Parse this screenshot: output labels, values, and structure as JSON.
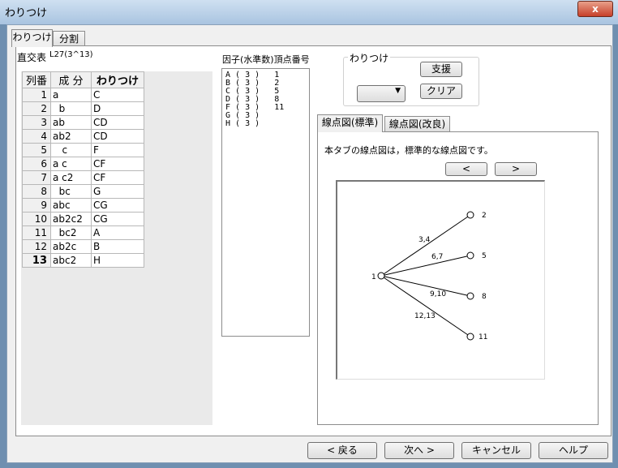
{
  "window": {
    "title": "わりつけ",
    "close_glyph": "x"
  },
  "tabs": [
    {
      "label": "わりつけ"
    },
    {
      "label": "分割"
    }
  ],
  "table_label": "直交表",
  "table_value": "L27(3^13)",
  "columns": [
    "列番",
    "成 分",
    "わりつけ"
  ],
  "rows": [
    {
      "num": "1",
      "comp": "a",
      "assign": "C"
    },
    {
      "num": "2",
      "comp": "  b",
      "assign": "D"
    },
    {
      "num": "3",
      "comp": "ab",
      "assign": "CD"
    },
    {
      "num": "4",
      "comp": "ab2",
      "assign": "CD"
    },
    {
      "num": "5",
      "comp": "   c",
      "assign": "F"
    },
    {
      "num": "6",
      "comp": "a c",
      "assign": "CF"
    },
    {
      "num": "7",
      "comp": "a c2",
      "assign": "CF"
    },
    {
      "num": "8",
      "comp": "  bc",
      "assign": "G"
    },
    {
      "num": "9",
      "comp": "abc",
      "assign": "CG"
    },
    {
      "num": "10",
      "comp": "ab2c2",
      "assign": "CG"
    },
    {
      "num": "11",
      "comp": "  bc2",
      "assign": "A"
    },
    {
      "num": "12",
      "comp": "ab2c",
      "assign": "B"
    },
    {
      "num": "13",
      "comp": "abc2",
      "assign": "H"
    }
  ],
  "factor_list": {
    "header": "因子(水準数)頂点番号",
    "lines": [
      "A ( 3 )   1",
      "B ( 3 )   2",
      "C ( 3 )   5",
      "D ( 3 )   8",
      "F ( 3 )   11",
      "G ( 3 )",
      "H ( 3 )"
    ]
  },
  "assign_group": {
    "label": "わりつけ",
    "support": "支援",
    "clear": "クリア",
    "combo_value": ""
  },
  "subtabs": [
    {
      "label": "線点図(標準)"
    },
    {
      "label": "線点図(改良)"
    }
  ],
  "subtab_desc": "本タブの線点図は，標準的な線点図です。",
  "nav": {
    "prev": "<",
    "next": ">"
  },
  "diagram": {
    "center": "1",
    "nodes": [
      "2",
      "5",
      "8",
      "11"
    ],
    "edges": [
      "3,4",
      "6,7",
      "9,10",
      "12,13"
    ]
  },
  "footer": {
    "back": "< 戻る",
    "next": "次へ >",
    "cancel": "キャンセル",
    "help": "ヘルプ"
  }
}
